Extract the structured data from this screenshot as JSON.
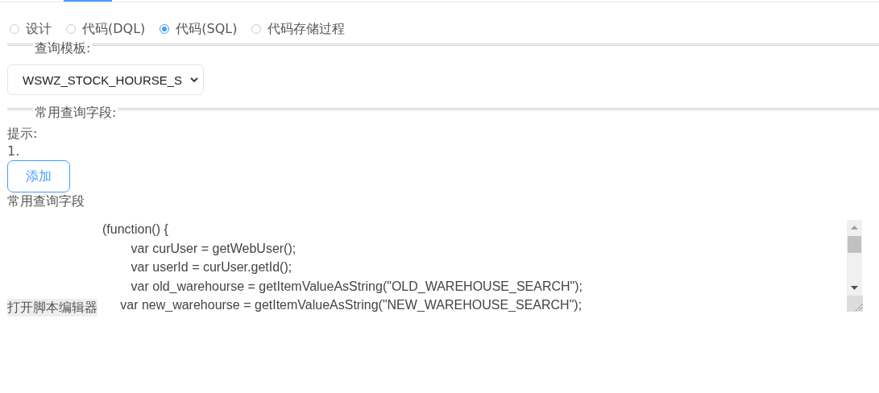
{
  "modes": [
    {
      "label": "设计",
      "selected": false
    },
    {
      "label": "代码(DQL)",
      "selected": false
    },
    {
      "label": "代码(SQL)",
      "selected": true
    },
    {
      "label": "代码存储过程",
      "selected": false
    }
  ],
  "query_template": {
    "legend": "查询模板:",
    "value": "WSWZ_STOCK_HOURSE_S"
  },
  "common_fields": {
    "legend": "常用查询字段:",
    "hint_label": "提示:",
    "hint_item": "1.",
    "add_button": "添加",
    "section_label": "常用查询字段"
  },
  "script": {
    "open_editor_button": "打开脚本编辑器",
    "code_lines": [
      "(function() {",
      "\tvar curUser = getWebUser();",
      "\tvar userId = curUser.getId();",
      "\tvar old_warehourse = getItemValueAsString(\"OLD_WAREHOUSE_SEARCH\");",
      "     var new_warehourse = getItemValueAsString(\"NEW_WAREHOUSE_SEARCH\");"
    ]
  }
}
